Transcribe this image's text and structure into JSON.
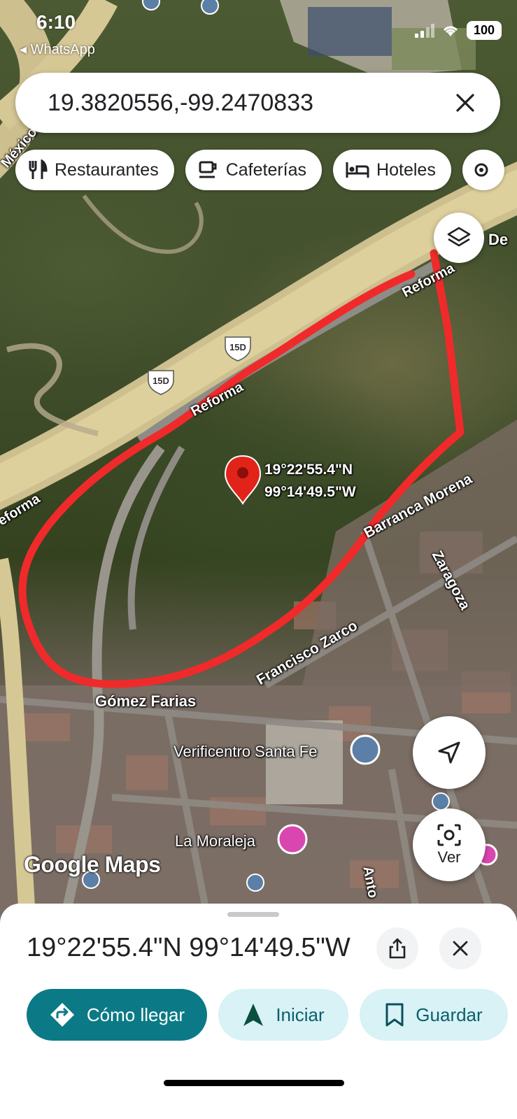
{
  "status_bar": {
    "time": "6:10",
    "back_label": "◂ WhatsApp",
    "battery": "100"
  },
  "search": {
    "query": "19.3820556,-99.2470833",
    "close_icon": "close-icon"
  },
  "chips": [
    {
      "label": "Restaurantes",
      "icon": "fork-knife-icon"
    },
    {
      "label": "Cafeterías",
      "icon": "coffee-cup-icon"
    },
    {
      "label": "Hoteles",
      "icon": "bed-icon"
    }
  ],
  "map": {
    "pin_label_lat": "19°22'55.4\"N",
    "pin_label_lng": "99°14'49.5\"W",
    "street_labels": {
      "reforma_top": "Reforma",
      "reforma_mid": "Reforma",
      "reforma_left": "eforma",
      "mexico": "México",
      "barranca_morena": "Barranca Morena",
      "zaragoza": "Zaragoza",
      "francisco_zarco": "Francisco Zarco",
      "gomez_farias": "Gómez Farias",
      "verificentro": "Verificentro Santa Fe",
      "la_moraleja": "La Moraleja",
      "anto": "Anto",
      "de_fragment": "De",
      "highway_shield_1": "15D",
      "highway_shield_2": "15D"
    },
    "outline_color": "#f02a2a",
    "pin_color": "#e2231a",
    "google_logo": "Google Maps"
  },
  "fabs": {
    "layers_icon": "layers-icon",
    "locate_icon": "navigation-arrow-icon",
    "lens_label": "Ver"
  },
  "sheet": {
    "title": "19°22'55.4\"N 99°14'49.5\"W",
    "actions": {
      "directions": "Cómo llegar",
      "start": "Iniciar",
      "save": "Guardar"
    },
    "accent_color": "#0b7a86"
  }
}
